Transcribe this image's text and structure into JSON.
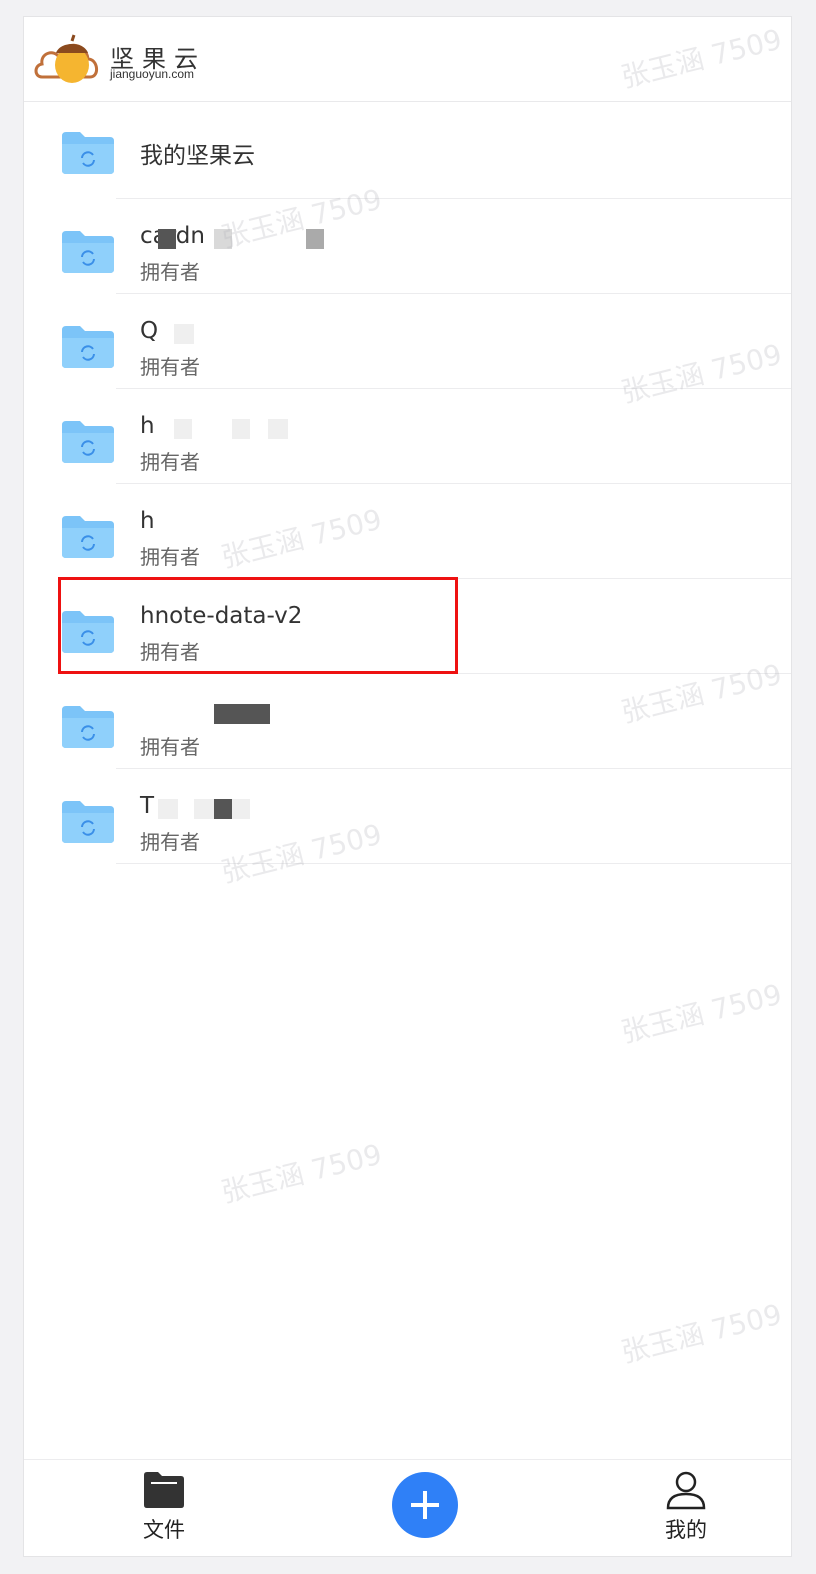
{
  "header": {
    "logo_cn": "坚果云",
    "logo_en": "jianguoyun.com"
  },
  "watermark": "张玉涵 7509",
  "folders": [
    {
      "name": "我的坚果云",
      "owner": ""
    },
    {
      "name": "cardn",
      "owner": "拥有者"
    },
    {
      "name": "Q",
      "owner": "拥有者"
    },
    {
      "name": "h",
      "owner": "拥有者"
    },
    {
      "name": "h",
      "owner": "拥有者"
    },
    {
      "name": "hnote-data-v2",
      "owner": "拥有者"
    },
    {
      "name": "",
      "owner": "拥有者"
    },
    {
      "name": "T",
      "owner": "拥有者"
    }
  ],
  "tabbar": {
    "files_label": "文件",
    "add_icon": "plus-icon",
    "mine_label": "我的"
  },
  "colors": {
    "accent": "#2f80f7",
    "folder": "#7cc4f8",
    "highlight": "#e11111"
  }
}
